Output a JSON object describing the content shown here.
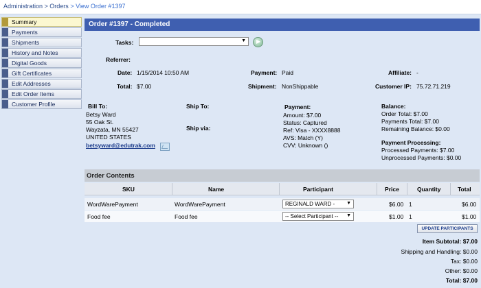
{
  "breadcrumb": {
    "items": [
      "Administration",
      "> Orders",
      "> View Order #1397"
    ]
  },
  "sidebar": {
    "items": [
      {
        "label": "Summary",
        "active": true
      },
      {
        "label": "Payments"
      },
      {
        "label": "Shipments"
      },
      {
        "label": "History and Notes"
      },
      {
        "label": "Digital Goods"
      },
      {
        "label": "Gift Certificates"
      },
      {
        "label": "Edit Addresses"
      },
      {
        "label": "Edit Order Items"
      },
      {
        "label": "Customer Profile"
      }
    ]
  },
  "order": {
    "title": "Order #1397 - Completed",
    "tasks_label": "Tasks:",
    "tasks_value": "",
    "referrer_label": "Referrer:",
    "date_label": "Date:",
    "date_value": "1/15/2014 10:50 AM",
    "payment_label": "Payment:",
    "payment_value": "Paid",
    "affiliate_label": "Affiliate:",
    "affiliate_value": "-",
    "total_label": "Total:",
    "total_value": "$7.00",
    "shipment_label": "Shipment:",
    "shipment_value": "NonShippable",
    "customer_ip_label": "Customer IP:",
    "customer_ip_value": "75.72.71.219"
  },
  "billing": {
    "bill_to_label": "Bill To:",
    "name": "Betsy Ward",
    "street": "55 Oak St.",
    "city": "Wayzata, MN 55427",
    "country": "UNITED STATES",
    "email": "betsyward@edutrak.com",
    "ship_to_label": "Ship To:",
    "ship_via_label": "Ship via:"
  },
  "payment_box": {
    "label": "Payment:",
    "amount": "Amount: $7.00",
    "status": "Status: Captured",
    "ref": "Ref: Visa - XXXX8888",
    "avs": "AVS: Match (Y)",
    "cvv": "CVV: Unknown ()"
  },
  "balance_box": {
    "label": "Balance:",
    "order_total": "Order Total: $7.00",
    "payments_total": "Payments Total: $7.00",
    "remaining": "Remaining Balance: $0.00",
    "processing_label": "Payment Processing:",
    "processed": "Processed Payments: $7.00",
    "unprocessed": "Unprocessed Payments: $0.00"
  },
  "contents": {
    "title": "Order Contents",
    "headers": {
      "sku": "SKU",
      "name": "Name",
      "participant": "Participant",
      "price": "Price",
      "quantity": "Quantity",
      "total": "Total"
    },
    "rows": [
      {
        "sku": "WordWarePayment",
        "name": "WordWarePayment",
        "participant": "REGINALD WARD -",
        "price": "$6.00",
        "quantity": "1",
        "total": "$6.00"
      },
      {
        "sku": "Food fee",
        "name": "Food fee",
        "participant": "-- Select Participant --",
        "price": "$1.00",
        "quantity": "1",
        "total": "$1.00"
      }
    ],
    "update_button": "UPDATE PARTICIPANTS"
  },
  "totals": {
    "subtotal": "Item Subtotal: $7.00",
    "shipping": "Shipping and Handling: $0.00",
    "tax": "Tax: $0.00",
    "other": "Other: $0.00",
    "total": "Total: $7.00"
  },
  "colors": {
    "header_bg": "#3f5fb0",
    "page_bg": "#dde7f5",
    "link": "#1a3a8a"
  }
}
